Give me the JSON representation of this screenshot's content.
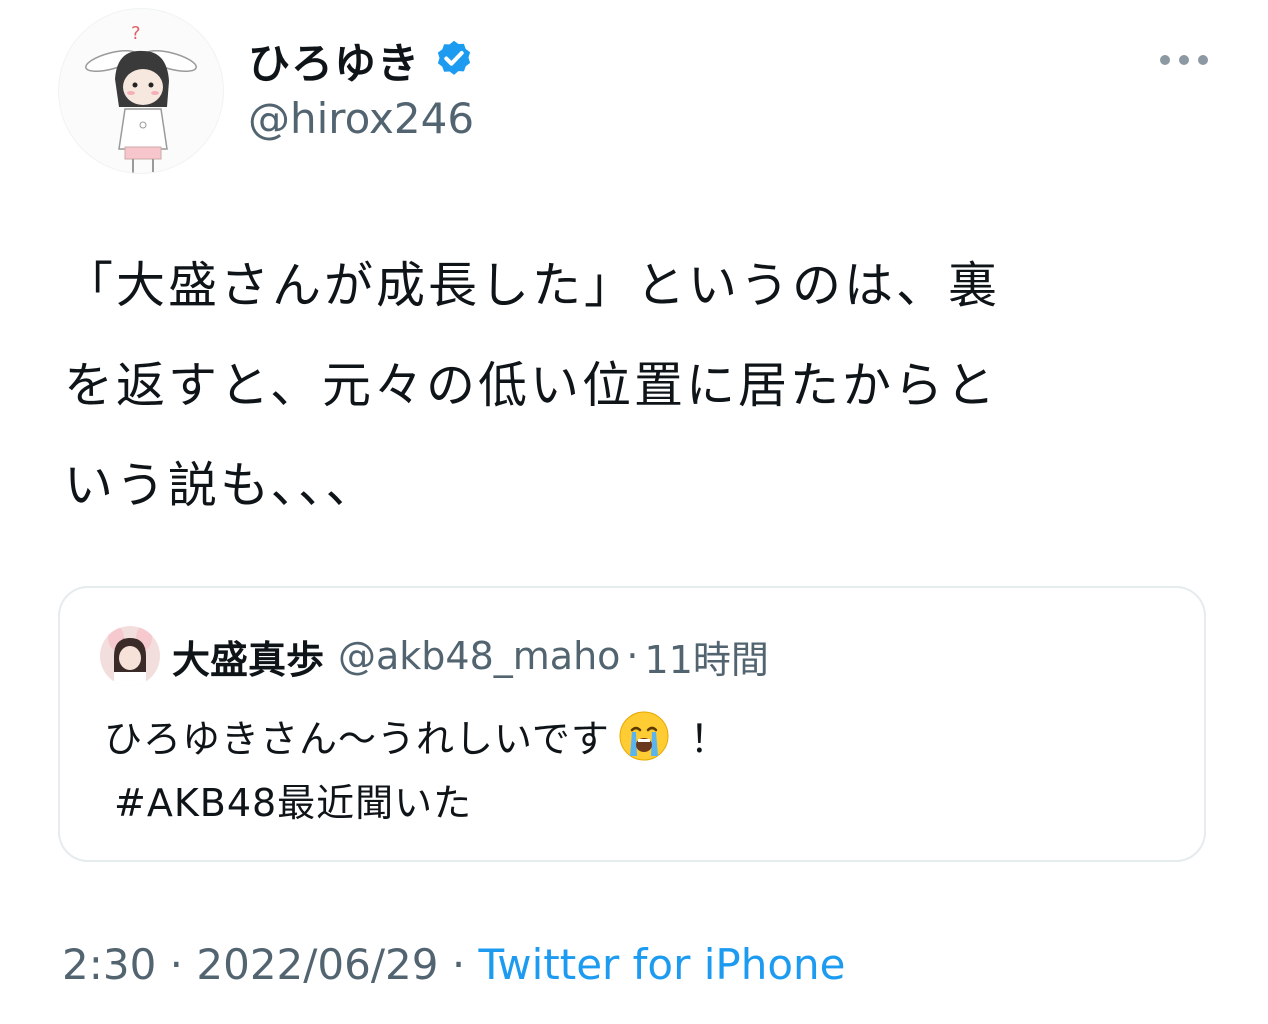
{
  "author": {
    "display_name": "ひろゆき",
    "handle": "@hirox246",
    "avatar_icon": "bunny-character-avatar",
    "verified_icon": "verified-badge-icon"
  },
  "more_icon": "more-options-icon",
  "tweet": {
    "text": "「大盛さんが成長した」というのは、裏\nを返すと、元々の低い位置に居たからと\nいう説も、、、"
  },
  "quoted_tweet": {
    "display_name": "大盛真歩",
    "handle": "@akb48_maho",
    "separator": "·",
    "time": "11時間",
    "text_before_emoji": "ひろゆきさん〜うれしいです",
    "emoji": "loudly-crying-face",
    "text_after_emoji": "！",
    "hashtag_line": "#AKB48最近聞いた"
  },
  "footer": {
    "time": "2:30",
    "separator": " · ",
    "date": "2022/06/29",
    "source": "Twitter for iPhone"
  },
  "colors": {
    "text": "#0f1419",
    "secondary": "#536471",
    "link": "#1d9bf0",
    "verified": "#1d9bf0",
    "border": "#e6ebee"
  }
}
